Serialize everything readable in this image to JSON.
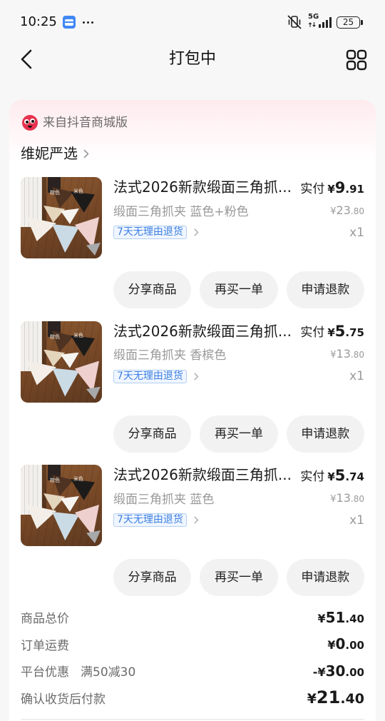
{
  "status_bar": {
    "time": "10:25",
    "network": "5G",
    "battery": "25",
    "icons": [
      "wallet-app-icon",
      "more-dots-icon",
      "vibrate-off-icon",
      "data-arrows-icon",
      "signal-icon",
      "battery-icon"
    ]
  },
  "header": {
    "title": "打包中",
    "back_icon": "chevron-left-icon",
    "menu_icon": "grid-icon"
  },
  "order": {
    "source": {
      "label": "来自抖音商城版",
      "icon": "douyin-mall-logo"
    },
    "shop": {
      "name": "维妮严选",
      "icon": "chevron-right-icon"
    },
    "product_actions": [
      "分享商品",
      "再买一单",
      "申请退款"
    ],
    "products": [
      {
        "title": "法式2026新款缎面三角抓...",
        "spec": "缎面三角抓夹 蓝色+粉色",
        "paid_label": "实付",
        "paid": {
          "symbol": "¥",
          "int": "9",
          "dec": ".91"
        },
        "original": {
          "symbol": "¥",
          "int": "23",
          "dec": ".80"
        },
        "service_tag": "7天无理由退货",
        "quantity": "x1",
        "photo_labels": [
          "棕色",
          "米色"
        ]
      },
      {
        "title": "法式2026新款缎面三角抓...",
        "spec": "缎面三角抓夹 香槟色",
        "paid_label": "实付",
        "paid": {
          "symbol": "¥",
          "int": "5",
          "dec": ".75"
        },
        "original": {
          "symbol": "¥",
          "int": "13",
          "dec": ".80"
        },
        "service_tag": "7天无理由退货",
        "quantity": "x1",
        "photo_labels": [
          "棕色",
          "米色"
        ]
      },
      {
        "title": "法式2026新款缎面三角抓...",
        "spec": "缎面三角抓夹 蓝色",
        "paid_label": "实付",
        "paid": {
          "symbol": "¥",
          "int": "5",
          "dec": ".74"
        },
        "original": {
          "symbol": "¥",
          "int": "13",
          "dec": ".80"
        },
        "service_tag": "7天无理由退货",
        "quantity": "x1",
        "photo_labels": [
          "棕色",
          "米色"
        ]
      }
    ],
    "summary": {
      "goods_total": {
        "label": "商品总价",
        "symbol": "¥",
        "int": "51",
        "dec": ".40"
      },
      "shipping": {
        "label": "订单运费",
        "symbol": "¥",
        "int": "0",
        "dec": ".00"
      },
      "discount": {
        "label": "平台优惠",
        "detail": "满50减30",
        "sign": "-",
        "symbol": "¥",
        "int": "30",
        "dec": ".00"
      },
      "pay_on_receipt": {
        "label": "确认收货后付款",
        "symbol": "¥",
        "int": "21",
        "dec": ".40"
      }
    }
  },
  "colors": {
    "accent_blue": "#3b7fe2",
    "text_primary": "#1a1a1a",
    "text_secondary": "#999999",
    "button_bg": "#f2f2f2",
    "card_tint": "#fdeaee",
    "brand_red": "#e6324f"
  }
}
